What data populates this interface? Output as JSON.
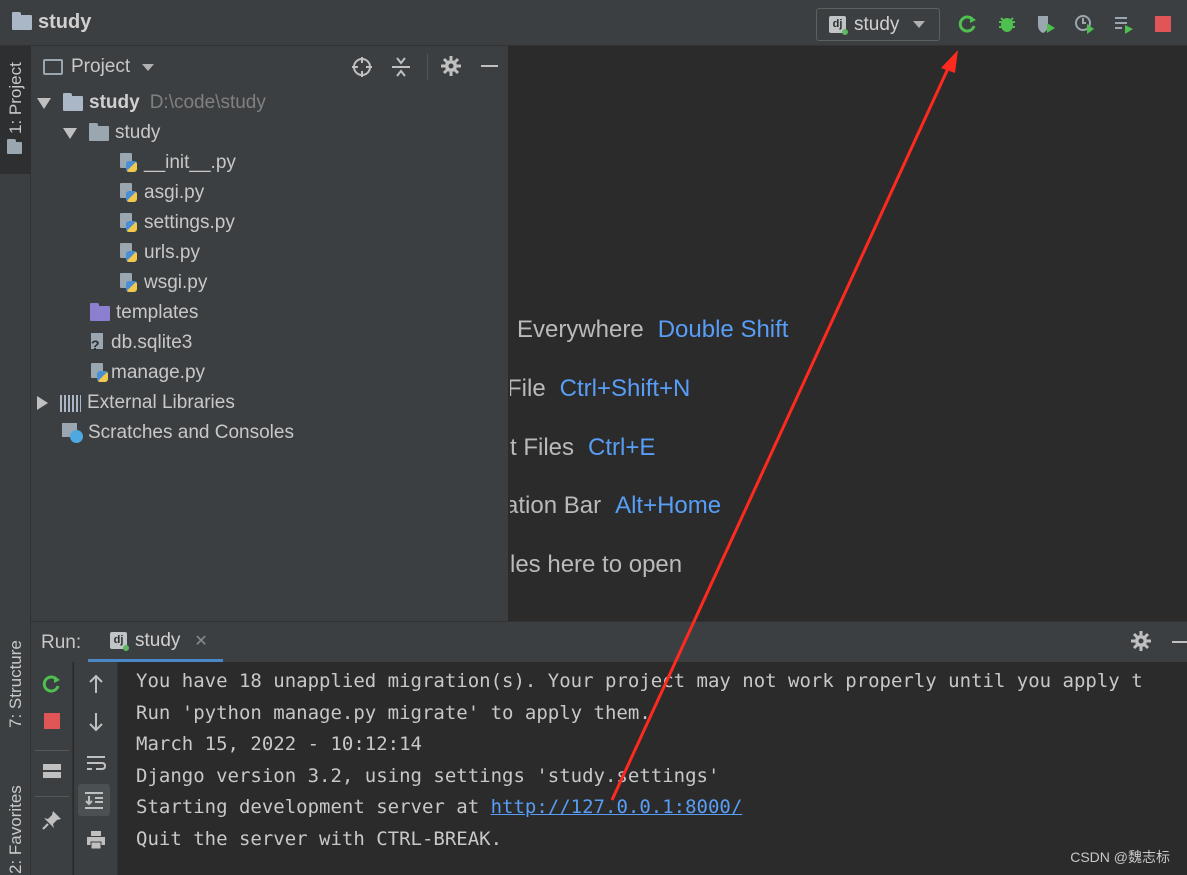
{
  "titlebar": {
    "project_name": "study",
    "run_config": "study"
  },
  "leftstrip": {
    "project_tab": "1: Project",
    "structure_tab": "7: Structure",
    "favorites_tab": "2: Favorites"
  },
  "project_panel": {
    "title": "Project",
    "tree": {
      "root": {
        "name": "study",
        "path": "D:\\code\\study"
      },
      "pkg": "study",
      "files": [
        "__init__.py",
        "asgi.py",
        "settings.py",
        "urls.py",
        "wsgi.py"
      ],
      "templates": "templates",
      "db": "db.sqlite3",
      "manage": "manage.py",
      "ext_libs": "External Libraries",
      "scratches": "Scratches and Consoles"
    }
  },
  "editor_hints": [
    {
      "text": "Everywhere",
      "key": "Double Shift"
    },
    {
      "text": "File",
      "key": "Ctrl+Shift+N"
    },
    {
      "text": "t Files",
      "key": "Ctrl+E"
    },
    {
      "text": "ation Bar",
      "key": "Alt+Home"
    },
    {
      "text": "les here to open",
      "key": ""
    }
  ],
  "run_panel": {
    "label": "Run:",
    "tab": "study",
    "console": [
      "You have 18 unapplied migration(s). Your project may not work properly until you apply t",
      "Run 'python manage.py migrate' to apply them.",
      "March 15, 2022 - 10:12:14",
      "Django version 3.2, using settings 'study.settings'",
      "Starting development server at ",
      "Quit the server with CTRL-BREAK."
    ],
    "server_url": "http://127.0.0.1:8000/"
  },
  "watermark": "CSDN @魏志标",
  "colors": {
    "accent_green": "#4fbf4f",
    "stop_red": "#e05555",
    "link_blue": "#589df6",
    "annotation_arrow": "#ff2a1f"
  }
}
